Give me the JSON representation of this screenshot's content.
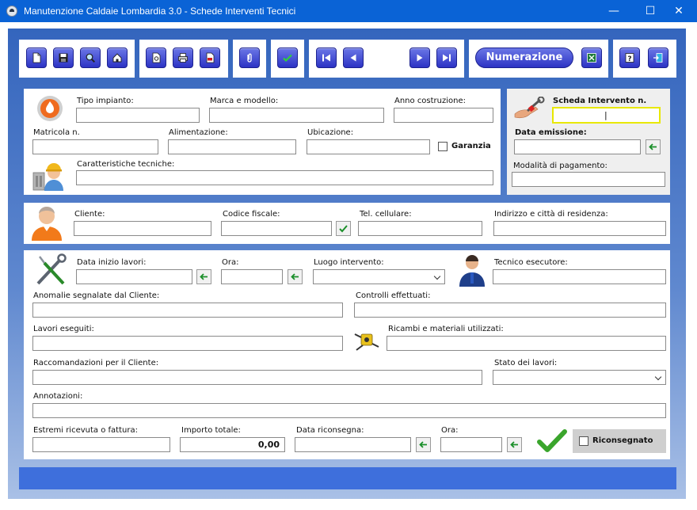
{
  "window": {
    "title": "Manutenzione Caldaie Lombardia 3.0 - Schede Interventi Tecnici",
    "minimize": "—",
    "maximize": "☐",
    "close": "✕"
  },
  "toolbar": {
    "numerazione_label": "Numerazione"
  },
  "impianto": {
    "tipo_impianto": "Tipo impianto:",
    "marca_modello": "Marca e modello:",
    "anno_costruzione": "Anno costruzione:",
    "matricola": "Matricola n.",
    "alimentazione": "Alimentazione:",
    "ubicazione": "Ubicazione:",
    "garanzia": "Garanzia",
    "caratteristiche": "Caratteristiche tecniche:"
  },
  "scheda": {
    "numero_label": "Scheda Intervento n.",
    "numero_value": "|",
    "data_emissione": "Data emissione:",
    "modalita_pagamento": "Modalità di pagamento:"
  },
  "cliente": {
    "cliente": "Cliente:",
    "codice_fiscale": "Codice fiscale:",
    "tel_cellulare": "Tel. cellulare:",
    "indirizzo": "Indirizzo e città di residenza:"
  },
  "intervento": {
    "data_inizio": "Data inizio lavori:",
    "ora": "Ora:",
    "luogo": "Luogo intervento:",
    "tecnico": "Tecnico esecutore:",
    "anomalie": "Anomalie segnalate dal Cliente:",
    "controlli": "Controlli effettuati:",
    "lavori": "Lavori eseguiti:",
    "ricambi": "Ricambi e materiali utilizzati:",
    "raccomandazioni": "Raccomandazioni per il Cliente:",
    "stato": "Stato dei lavori:",
    "annotazioni": "Annotazioni:",
    "estremi": "Estremi ricevuta o fattura:",
    "importo": "Importo totale:",
    "importo_value": "0,00",
    "data_riconsegna": "Data riconsegna:",
    "ora_riconsegna": "Ora:",
    "riconsegnato": "Riconsegnato"
  },
  "colors": {
    "titlebar": "#0a63d6",
    "button": "#2c33c4",
    "highlight": "#e8e800",
    "footer": "#3e6fdc"
  }
}
